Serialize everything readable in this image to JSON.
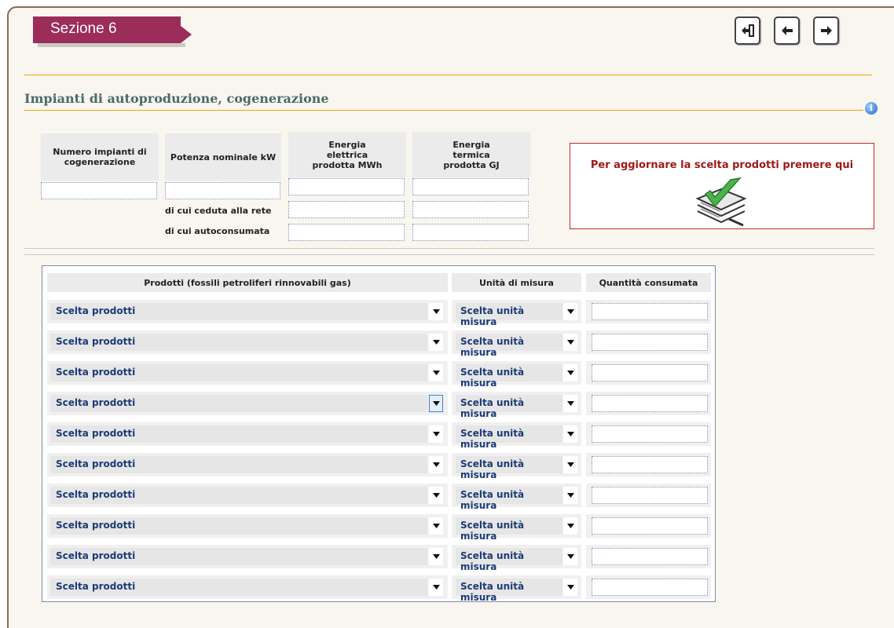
{
  "section": {
    "tab_label": "Sezione 6"
  },
  "nav": {
    "icons": [
      "exit-icon",
      "arrow-left-icon",
      "arrow-right-icon"
    ]
  },
  "page": {
    "title": "Impianti di autoproduzione, cogenerazione",
    "info_icon": "info-icon"
  },
  "summary": {
    "headers": {
      "impianti": "Numero impianti di cogenerazione",
      "potenza": "Potenza nominale kW",
      "elettrica": "Energia elettrica prodotta MWh",
      "termica": "Energia termica prodotta GJ"
    },
    "labels": {
      "ceduta": "di cui ceduta alla rete",
      "autoconsumata": "di cui autoconsumata"
    },
    "values": {
      "impianti": "",
      "potenza": "",
      "elettrica_totale": "",
      "termica_totale": "",
      "elettrica_ceduta": "",
      "termica_ceduta": "",
      "elettrica_autoconsumata": "",
      "termica_autoconsumata": ""
    }
  },
  "update_box": {
    "text": "Per aggiornare la scelta prodotti premere qui",
    "icon": "checklist-icon"
  },
  "products": {
    "headers": {
      "prodotti": "Prodotti (fossili petroliferi rinnovabili gas)",
      "unita": "Unità di misura",
      "quantita": "Quantità consumata"
    },
    "rows": [
      {
        "product": "Scelta prodotti",
        "unit": "Scelta unità misura",
        "qty": ""
      },
      {
        "product": "Scelta prodotti",
        "unit": "Scelta unità misura",
        "qty": ""
      },
      {
        "product": "Scelta prodotti",
        "unit": "Scelta unità misura",
        "qty": ""
      },
      {
        "product": "Scelta prodotti",
        "unit": "Scelta unità misura",
        "qty": ""
      },
      {
        "product": "Scelta prodotti",
        "unit": "Scelta unità misura",
        "qty": ""
      },
      {
        "product": "Scelta prodotti",
        "unit": "Scelta unità misura",
        "qty": ""
      },
      {
        "product": "Scelta prodotti",
        "unit": "Scelta unità misura",
        "qty": ""
      },
      {
        "product": "Scelta prodotti",
        "unit": "Scelta unità misura",
        "qty": ""
      },
      {
        "product": "Scelta prodotti",
        "unit": "Scelta unità misura",
        "qty": ""
      },
      {
        "product": "Scelta prodotti",
        "unit": "Scelta unità misura",
        "qty": ""
      }
    ]
  },
  "colors": {
    "tab": "#9c2c5a",
    "accent_line": "#f0a500",
    "title": "#4a6b6b",
    "alert": "#a01818",
    "select_text": "#1b3a77"
  }
}
